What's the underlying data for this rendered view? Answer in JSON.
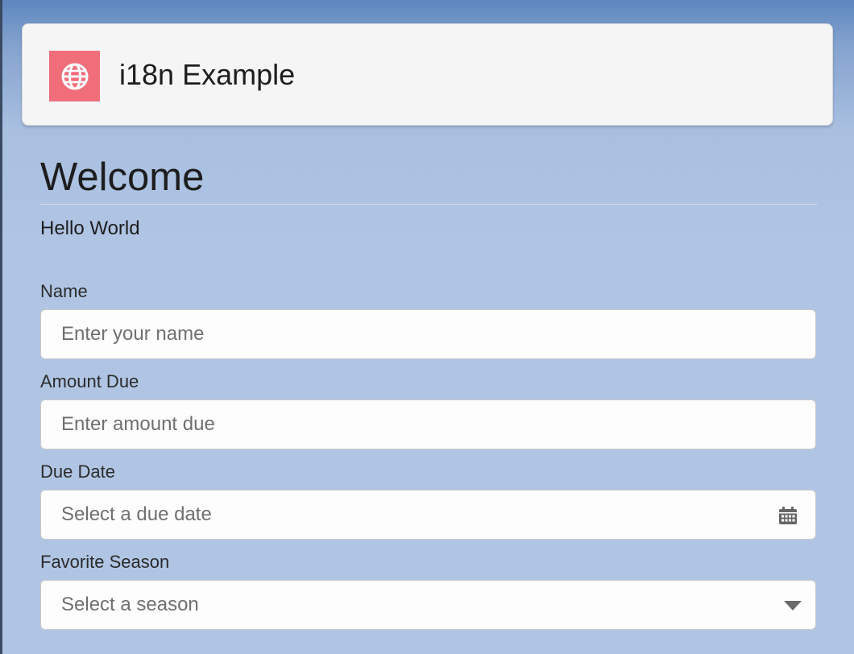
{
  "header": {
    "app_icon": "globe-icon",
    "title": "i18n Example",
    "accent_color": "#ef6e7a"
  },
  "main": {
    "heading": "Welcome",
    "greeting": "Hello World"
  },
  "form": {
    "name": {
      "label": "Name",
      "placeholder": "Enter your name",
      "value": ""
    },
    "amount_due": {
      "label": "Amount Due",
      "placeholder": "Enter amount due",
      "value": ""
    },
    "due_date": {
      "label": "Due Date",
      "placeholder": "Select a due date",
      "value": "",
      "icon": "calendar-icon"
    },
    "favorite_season": {
      "label": "Favorite Season",
      "selected": "Select a season",
      "icon": "chevron-down-icon"
    }
  }
}
